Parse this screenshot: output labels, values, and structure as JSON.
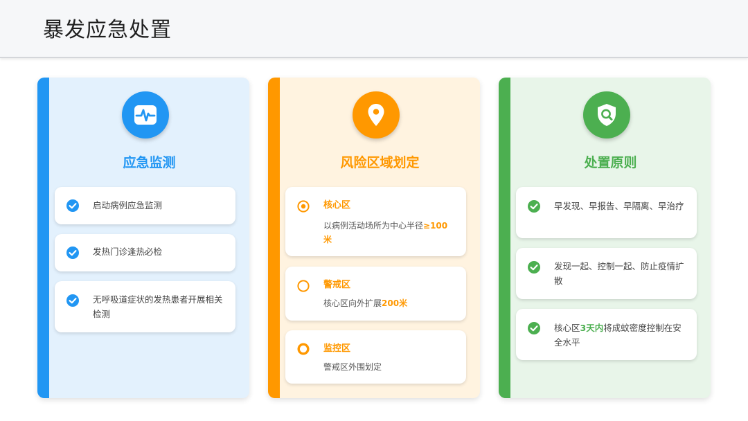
{
  "page": {
    "title": "暴发应急处置"
  },
  "colors": {
    "blue": "#2196f3",
    "orange": "#ff9800",
    "green": "#4caf50"
  },
  "panels": [
    {
      "title": "应急监测",
      "icon": "heartbeat-monitor-icon",
      "items": [
        {
          "text": "启动病例应急监测"
        },
        {
          "text": "发热门诊逢热必检"
        },
        {
          "text": "无呼吸道症状的发热患者开展相关检测"
        }
      ]
    },
    {
      "title": "风险区域划定",
      "icon": "location-pin-icon",
      "zones": [
        {
          "title": "核心区",
          "desc_prefix": "以病例活动场所为中心半径",
          "desc_highlight": "≥100米",
          "desc_suffix": ""
        },
        {
          "title": "警戒区",
          "desc_prefix": "核心区向外扩展",
          "desc_highlight": "200米",
          "desc_suffix": ""
        },
        {
          "title": "监控区",
          "desc_prefix": "警戒区外围划定",
          "desc_highlight": "",
          "desc_suffix": ""
        }
      ]
    },
    {
      "title": "处置原则",
      "icon": "shield-search-icon",
      "items": [
        {
          "prefix": "早发现、早报告、早隔离、早治疗",
          "highlight": "",
          "suffix": ""
        },
        {
          "prefix": "发现一起、控制一起、防止疫情扩散",
          "highlight": "",
          "suffix": ""
        },
        {
          "prefix": "核心区",
          "highlight": "3天内",
          "suffix": "将成蚊密度控制在安全水平"
        }
      ]
    }
  ]
}
